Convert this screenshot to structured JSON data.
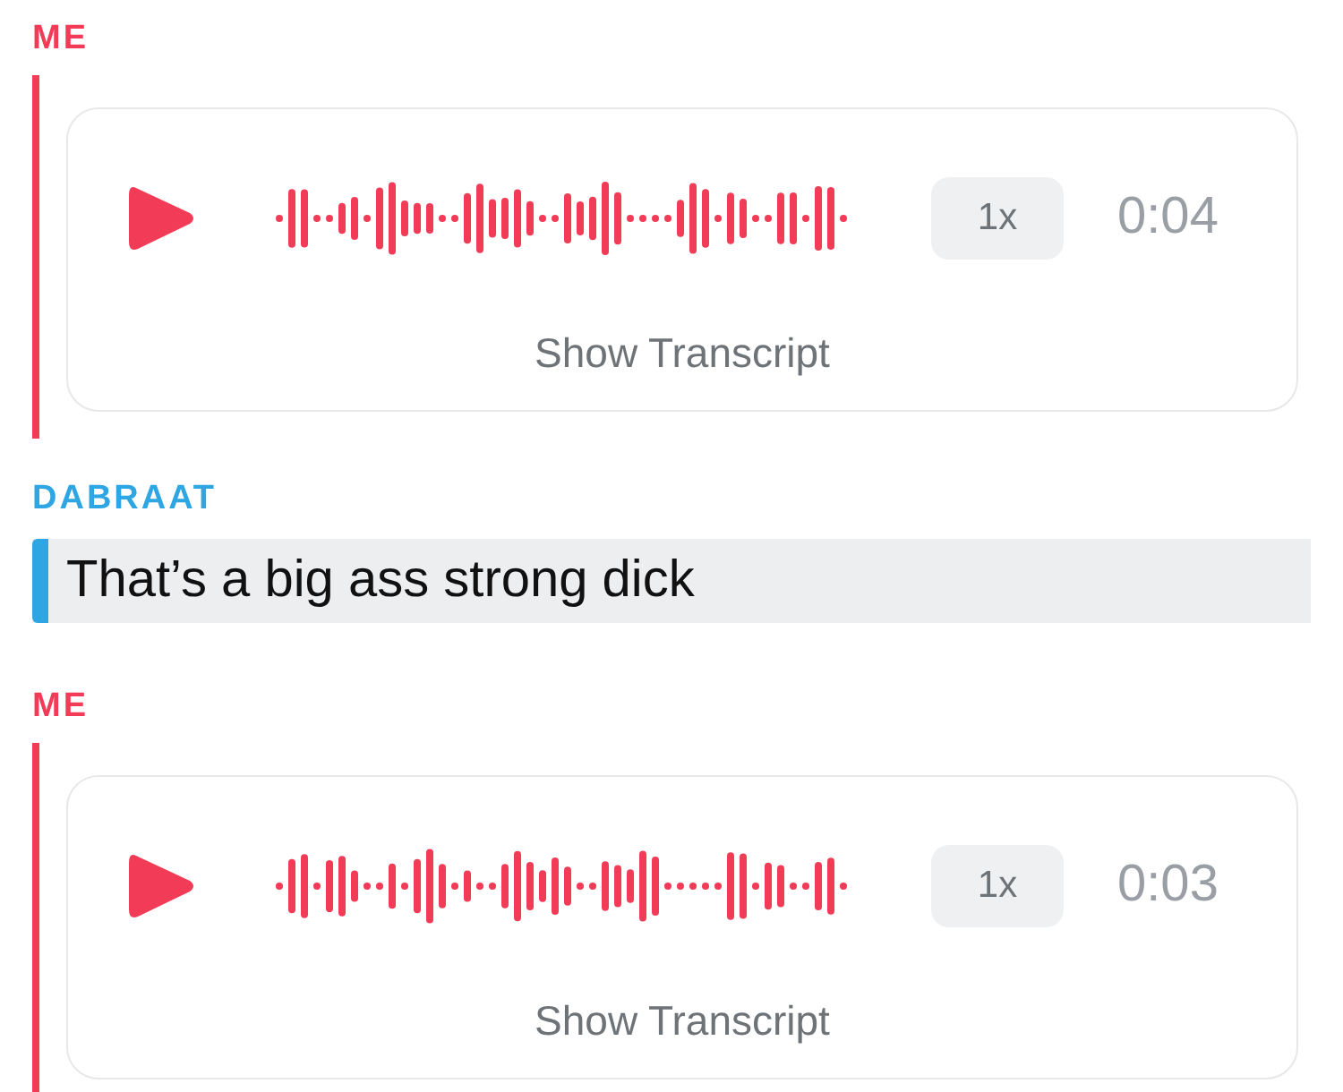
{
  "messages": [
    {
      "kind": "voice",
      "sender": "ME",
      "color": "#f23c57",
      "speed": "1x",
      "duration": "0:04",
      "action": "Show Transcript"
    },
    {
      "kind": "text",
      "sender": "DABRAAT",
      "color": "#2ea6e4",
      "text": "That’s a big ass strong dick"
    },
    {
      "kind": "voice",
      "sender": "ME",
      "color": "#f23c57",
      "speed": "1x",
      "duration": "0:03",
      "action": "Show Transcript"
    }
  ]
}
